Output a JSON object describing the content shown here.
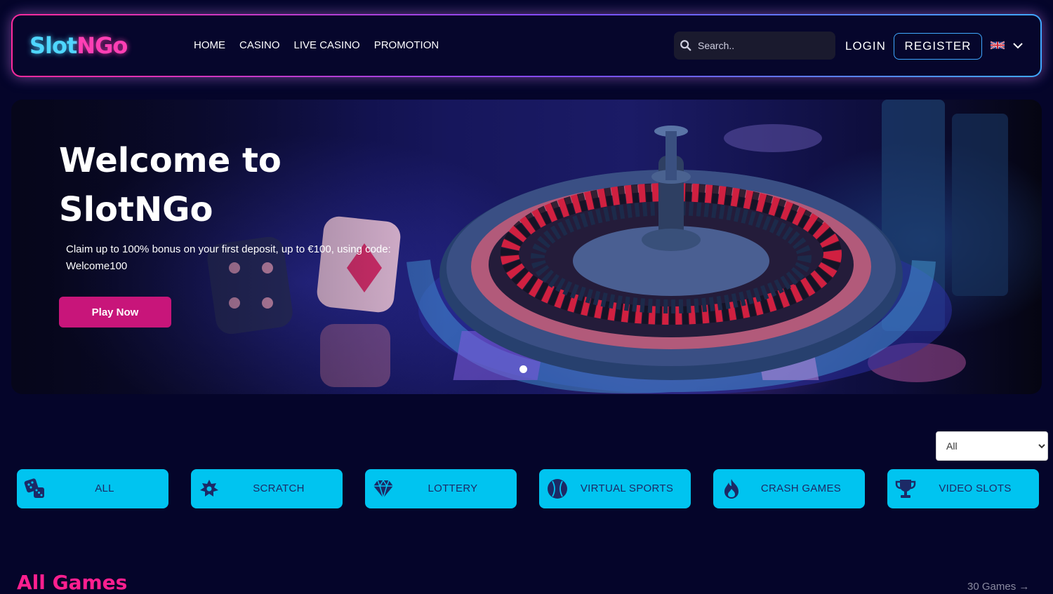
{
  "header": {
    "logo": {
      "part1": "Slot",
      "part2": "NGo"
    },
    "nav": [
      "HOME",
      "CASINO",
      "LIVE CASINO",
      "PROMOTION"
    ],
    "search": {
      "placeholder": "Search.."
    },
    "login_label": "LOGIN",
    "register_label": "REGISTER",
    "language": {
      "icon": "uk-flag-icon"
    }
  },
  "hero": {
    "title": "Welcome to SlotNGo",
    "subtitle": "Claim up to 100% bonus on your first deposit, up to €100, using code: Welcome100",
    "cta_label": "Play Now",
    "slide_count": 1
  },
  "filter": {
    "selected": "All",
    "options": [
      "All"
    ]
  },
  "categories": [
    {
      "label": "ALL",
      "icon": "dice-icon"
    },
    {
      "label": "SCRATCH",
      "icon": "puzzle-icon"
    },
    {
      "label": "LOTTERY",
      "icon": "diamond-icon"
    },
    {
      "label": "VIRTUAL SPORTS",
      "icon": "baseball-icon"
    },
    {
      "label": "CRASH GAMES",
      "icon": "fire-icon"
    },
    {
      "label": "VIDEO SLOTS",
      "icon": "trophy-icon"
    }
  ],
  "section": {
    "title": "All Games",
    "count_label": "30 Games →"
  },
  "colors": {
    "background": "#05052a",
    "accent_pink": "#ff1f8f",
    "accent_cyan": "#00c4f0",
    "cta": "#c8157a"
  }
}
